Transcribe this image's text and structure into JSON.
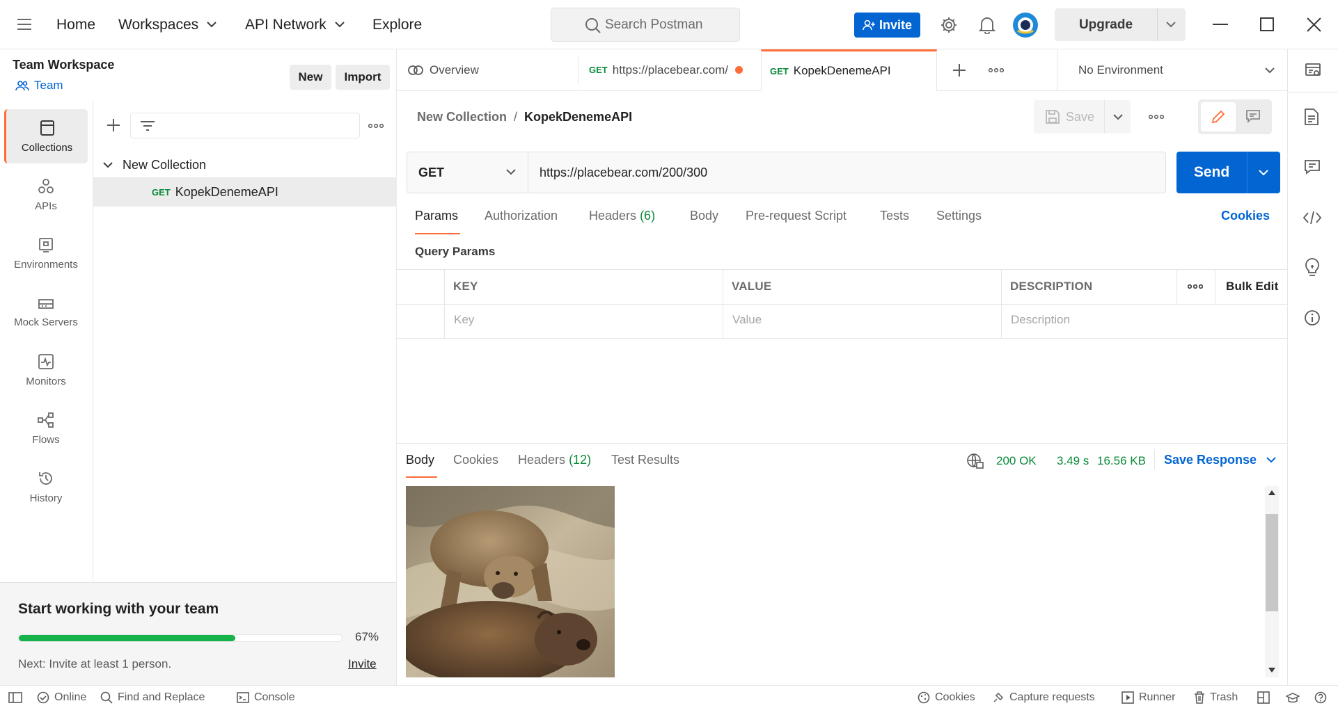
{
  "topbar": {
    "nav": [
      "Home",
      "Workspaces",
      "API Network",
      "Explore"
    ],
    "search_placeholder": "Search Postman",
    "invite_label": "Invite",
    "upgrade_label": "Upgrade"
  },
  "workspace": {
    "name": "Team Workspace",
    "type_label": "Team",
    "new_label": "New",
    "import_label": "Import"
  },
  "rail": [
    "Collections",
    "APIs",
    "Environments",
    "Mock Servers",
    "Monitors",
    "Flows",
    "History"
  ],
  "tree": {
    "collection": "New Collection",
    "request_method": "GET",
    "request_name": "KopekDenemeAPI"
  },
  "team_card": {
    "title": "Start working with your team",
    "progress_text": "67%",
    "progress": 0.67,
    "next_text": "Next: Invite at least 1 person.",
    "invite_link": "Invite"
  },
  "tabs": {
    "overview": "Overview",
    "tab2_method": "GET",
    "tab2_label": "https://placebear.com/",
    "tab3_method": "GET",
    "tab3_label": "KopekDenemeAPI",
    "environment": "No Environment"
  },
  "request": {
    "breadcrumb_parent": "New Collection",
    "breadcrumb_sep": "/",
    "breadcrumb_current": "KopekDenemeAPI",
    "save_label": "Save",
    "method": "GET",
    "url": "https://placebear.com/200/300",
    "send_label": "Send",
    "tabs": [
      "Params",
      "Authorization",
      "Headers",
      "Body",
      "Pre-request Script",
      "Tests",
      "Settings"
    ],
    "headers_count": "(6)",
    "cookies_link": "Cookies",
    "query_params_title": "Query Params",
    "columns": [
      "KEY",
      "VALUE",
      "DESCRIPTION"
    ],
    "bulk_edit": "Bulk Edit",
    "placeholders": [
      "Key",
      "Value",
      "Description"
    ]
  },
  "response": {
    "tabs": [
      "Body",
      "Cookies",
      "Headers",
      "Test Results"
    ],
    "headers_count": "(12)",
    "status": "200 OK",
    "time": "3.49 s",
    "size": "16.56 KB",
    "save_response": "Save Response"
  },
  "statusbar": {
    "online": "Online",
    "find_replace": "Find and Replace",
    "console": "Console",
    "cookies": "Cookies",
    "capture": "Capture requests",
    "runner": "Runner",
    "trash": "Trash"
  },
  "colors": {
    "accent_orange": "#ff6c37",
    "primary_blue": "#0265d2",
    "success_green": "#0b8a3a",
    "progress_green": "#15b34a"
  }
}
